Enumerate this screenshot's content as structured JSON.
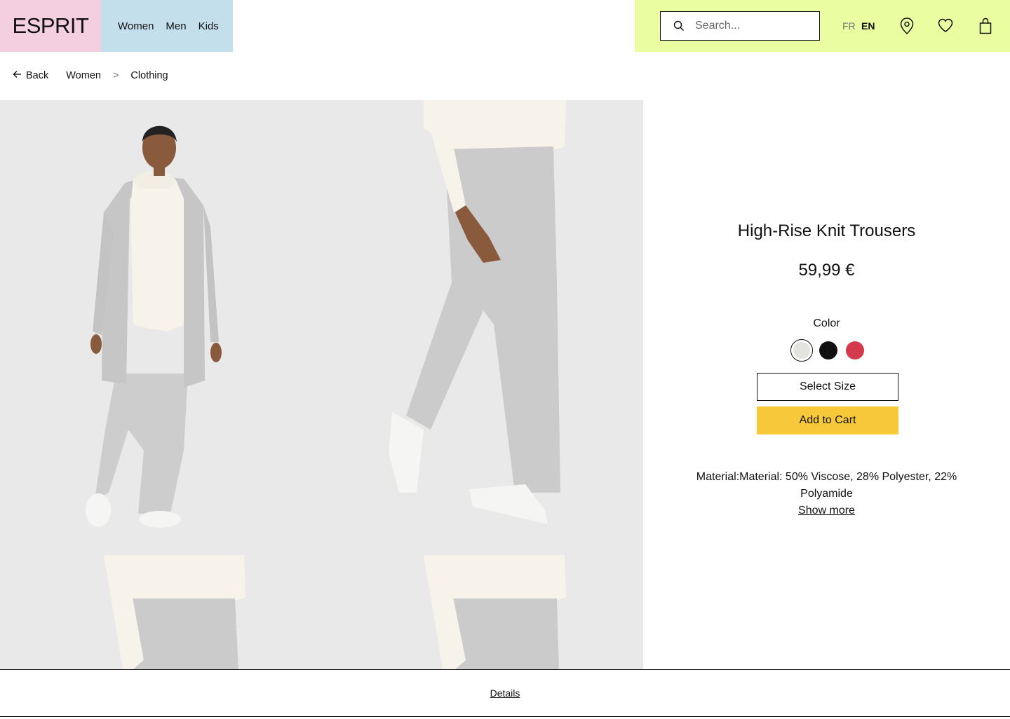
{
  "brand": {
    "logo_text": "ESPRIT"
  },
  "nav": {
    "items": [
      {
        "label": "Women"
      },
      {
        "label": "Men"
      },
      {
        "label": "Kids"
      }
    ]
  },
  "header": {
    "search_placeholder": "Search...",
    "lang_fr": "FR",
    "lang_en": "EN",
    "icons": [
      "search-icon",
      "location-pin-icon",
      "heart-icon",
      "shopping-bag-icon"
    ]
  },
  "breadcrumb": {
    "back_label": "Back",
    "level1": "Women",
    "separator": ">",
    "level2": "Clothing"
  },
  "product": {
    "title": "High-Rise Knit Trousers",
    "price": "59,99 €",
    "color_label": "Color",
    "swatches": [
      {
        "name": "light-grey",
        "color": "#e4e4df",
        "selected": true
      },
      {
        "name": "black",
        "color": "#111111",
        "selected": false
      },
      {
        "name": "red",
        "color": "#d33a4c",
        "selected": false
      }
    ],
    "select_size_label": "Select Size",
    "add_to_cart_label": "Add to Cart",
    "material_text": "Material:Material: 50% Viscose, 28% Polyester, 22% Polyamide",
    "show_more_label": "Show more"
  },
  "colors": {
    "pink": "#f3cfe0",
    "blue": "#c3dfec",
    "lime": "#ebfda1",
    "cart_yellow": "#f7c83a"
  },
  "details": {
    "label": "Details"
  }
}
